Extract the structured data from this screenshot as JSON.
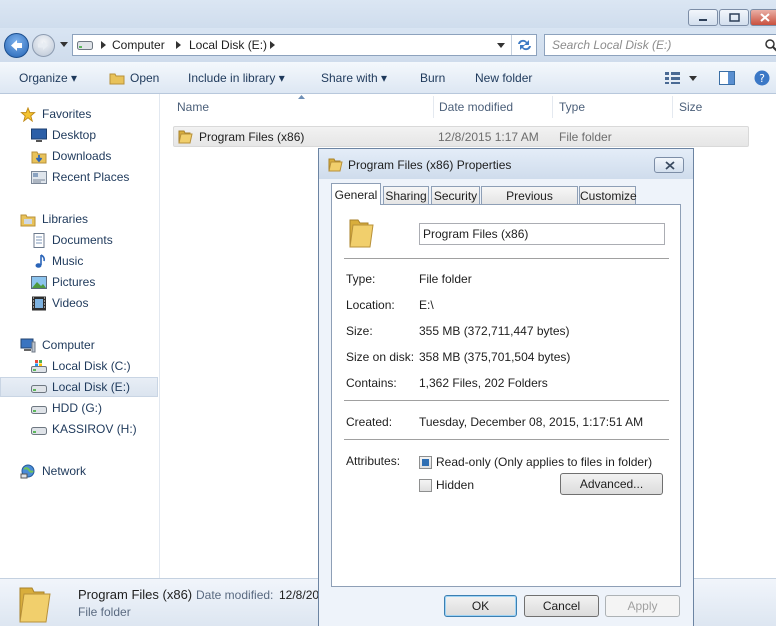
{
  "address": {
    "crumbs": [
      "Computer",
      "Local Disk (E:)"
    ],
    "search_placeholder": "Search Local Disk (E:)"
  },
  "toolbar": {
    "organize": "Organize ▾",
    "open": "Open",
    "include": "Include in library ▾",
    "share": "Share with ▾",
    "burn": "Burn",
    "new_folder": "New folder"
  },
  "nav": {
    "favorites": "Favorites",
    "desktop": "Desktop",
    "downloads": "Downloads",
    "recent": "Recent Places",
    "libraries": "Libraries",
    "documents": "Documents",
    "music": "Music",
    "pictures": "Pictures",
    "videos": "Videos",
    "computer": "Computer",
    "drive_c": "Local Disk (C:)",
    "drive_e": "Local Disk (E:)",
    "drive_g": "HDD (G:)",
    "drive_h": "KASSIROV (H:)",
    "network": "Network"
  },
  "columns": {
    "name": "Name",
    "date": "Date modified",
    "type": "Type",
    "size": "Size"
  },
  "file": {
    "name": "Program Files (x86)",
    "date": "12/8/2015 1:17 AM",
    "type": "File folder"
  },
  "details": {
    "name": "Program Files (x86)",
    "date_label": "Date modified:",
    "date_value": "12/8/20",
    "type": "File folder"
  },
  "dialog": {
    "title": "Program Files (x86) Properties",
    "tabs": [
      "General",
      "Sharing",
      "Security",
      "Previous Versions",
      "Customize"
    ],
    "folder_name": "Program Files (x86)",
    "type_label": "Type:",
    "type_value": "File folder",
    "location_label": "Location:",
    "location_value": "E:\\",
    "size_label": "Size:",
    "size_value": "355 MB (372,711,447 bytes)",
    "disk_label": "Size on disk:",
    "disk_value": "358 MB (375,701,504 bytes)",
    "contains_label": "Contains:",
    "contains_value": "1,362 Files, 202 Folders",
    "created_label": "Created:",
    "created_value": "Tuesday, December 08, 2015, 1:17:51 AM",
    "attributes_label": "Attributes:",
    "readonly_label": "Read-only (Only applies to files in folder)",
    "hidden_label": "Hidden",
    "advanced_label": "Advanced...",
    "ok_label": "OK",
    "cancel_label": "Cancel",
    "apply_label": "Apply"
  },
  "colors": {
    "accent": "#1e395b",
    "folder": "#e8c25a",
    "selection": "#cfe3fc"
  }
}
